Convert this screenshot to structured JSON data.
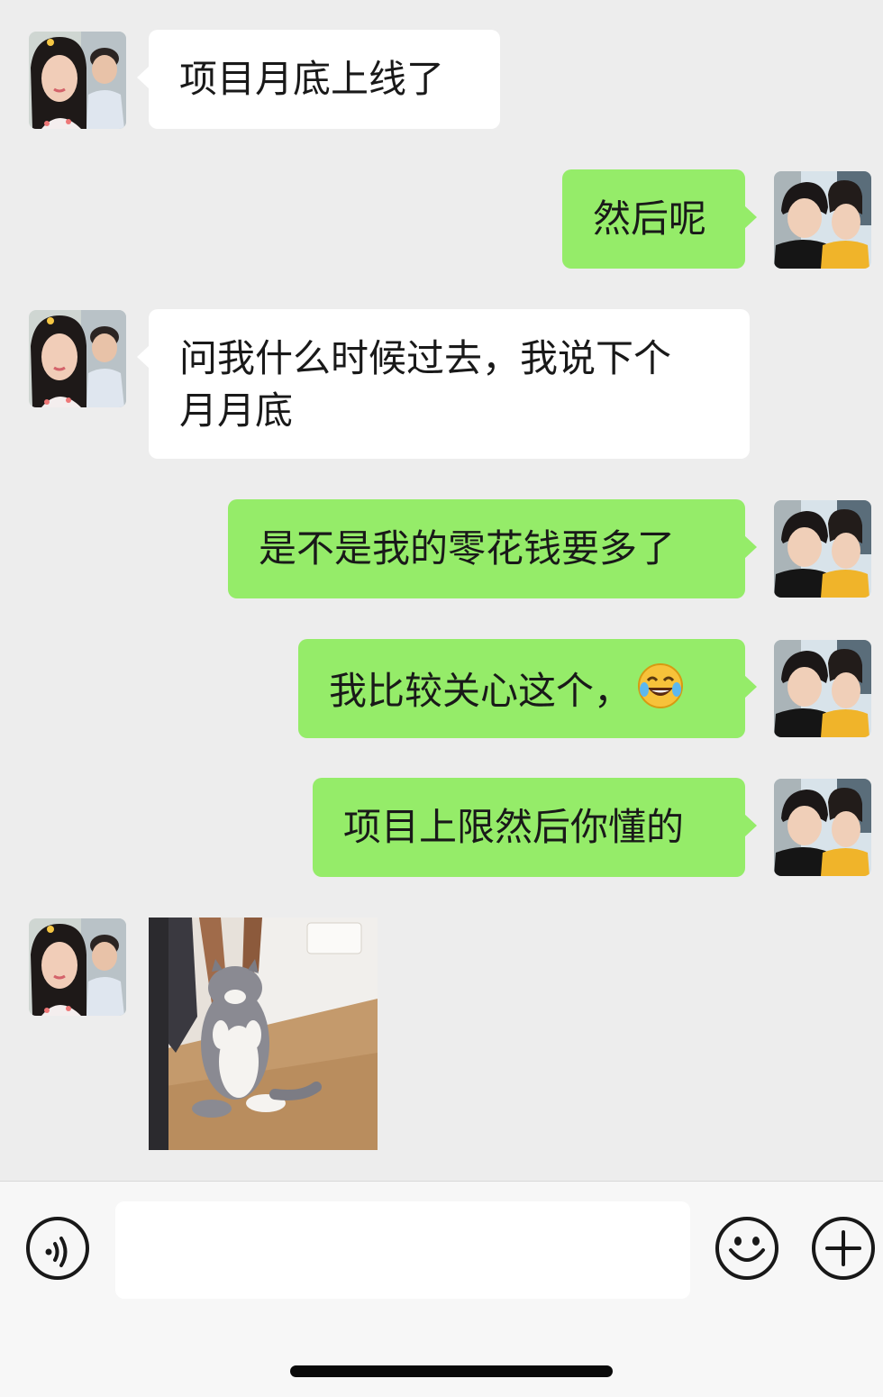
{
  "messages": [
    {
      "side": "incoming",
      "type": "text",
      "text": "项目月底上线了"
    },
    {
      "side": "outgoing",
      "type": "text",
      "text": "然后呢"
    },
    {
      "side": "incoming",
      "type": "text",
      "line1": "问我什么时候过去，我说下个",
      "line2": "月月底"
    },
    {
      "side": "outgoing",
      "type": "text",
      "text": "是不是我的零花钱要多了"
    },
    {
      "side": "outgoing",
      "type": "text",
      "text": "我比较关心这个，",
      "emoji": "tears-of-joy-emoji"
    },
    {
      "side": "outgoing",
      "type": "text",
      "text": "项目上限然后你懂的"
    },
    {
      "side": "incoming",
      "type": "image",
      "content": "cat-gif-sticker"
    }
  ],
  "input_bar": {
    "voice_icon": "voice-icon",
    "emoji_icon": "smiley-icon",
    "more_icon": "plus-circle-icon",
    "text_value": ""
  },
  "colors": {
    "background": "#ededed",
    "incoming_bubble": "#ffffff",
    "outgoing_bubble": "#95ec69",
    "text": "#191919"
  }
}
